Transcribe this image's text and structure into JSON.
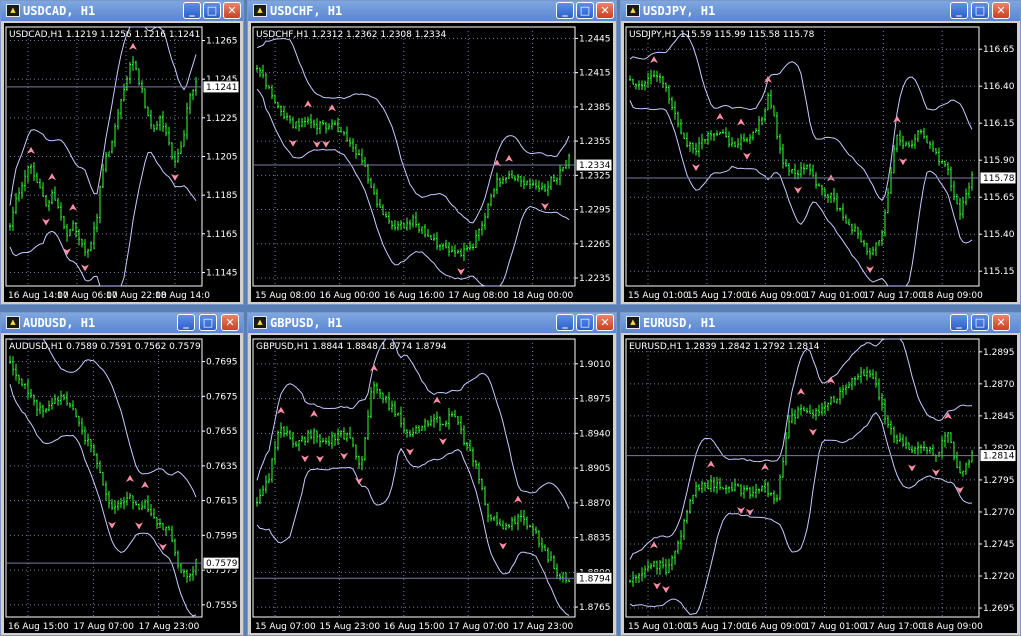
{
  "windows": [
    {
      "id": "usdcad",
      "title": "USDCAD, H1",
      "symbol_info": "USDCAD,H1  1.1219 1.1256 1.1216 1.1241",
      "last_price": "1.1241",
      "last_value": 1.1241,
      "y_ticks": [
        "1.1265",
        "1.1245",
        "1.1225",
        "1.1205",
        "1.1185",
        "1.1165",
        "1.1145"
      ],
      "y_range": [
        1.1138,
        1.1272
      ],
      "x_ticks": [
        "16 Aug 14:00",
        "17 Aug 06:00",
        "17 Aug 22:00",
        "18 Aug 14:0"
      ],
      "chart_data": {
        "type": "line",
        "series": [
          {
            "values": [
              1.117,
              1.1185,
              1.1195,
              1.12,
              1.119,
              1.118,
              1.1185,
              1.1175,
              1.1165,
              1.117,
              1.116,
              1.1155,
              1.117,
              1.12,
              1.121,
              1.1225,
              1.124,
              1.1255,
              1.1245,
              1.123,
              1.122,
              1.1225,
              1.1215,
              1.12,
              1.121,
              1.1235,
              1.1245
            ]
          }
        ]
      }
    },
    {
      "id": "usdchf",
      "title": "USDCHF, H1",
      "symbol_info": "USDCHF,H1  1.2312 1.2362 1.2308 1.2334",
      "last_price": "1.2334",
      "last_value": 1.2334,
      "y_ticks": [
        "1.2445",
        "1.2415",
        "1.2385",
        "1.2355",
        "1.2325",
        "1.2295",
        "1.2265",
        "1.2235"
      ],
      "y_range": [
        1.2228,
        1.2455
      ],
      "x_ticks": [
        "15 Aug 08:00",
        "16 Aug 00:00",
        "16 Aug 16:00",
        "17 Aug 08:00",
        "18 Aug 00:00"
      ],
      "chart_data": {
        "type": "line",
        "series": [
          {
            "values": [
              1.242,
              1.24,
              1.238,
              1.237,
              1.2372,
              1.2368,
              1.237,
              1.2365,
              1.235,
              1.233,
              1.23,
              1.2285,
              1.228,
              1.2285,
              1.2275,
              1.2265,
              1.226,
              1.2255,
              1.2265,
              1.229,
              1.232,
              1.2325,
              1.232,
              1.2318,
              1.2315,
              1.2325,
              1.234
            ]
          }
        ]
      }
    },
    {
      "id": "usdjpy",
      "title": "USDJPY, H1",
      "symbol_info": "USDJPY,H1  115.59 115.99 115.58 115.78",
      "last_price": "115.78",
      "last_value": 115.78,
      "y_ticks": [
        "116.65",
        "116.40",
        "116.15",
        "115.90",
        "115.65",
        "115.40",
        "115.15"
      ],
      "y_range": [
        115.05,
        116.8
      ],
      "x_ticks": [
        "15 Aug 01:00",
        "15 Aug 17:00",
        "16 Aug 09:00",
        "17 Aug 01:00",
        "17 Aug 17:00",
        "18 Aug 09:00"
      ],
      "chart_data": {
        "type": "line",
        "series": [
          {
            "values": [
              116.45,
              116.4,
              116.5,
              116.35,
              116.1,
              115.95,
              116.05,
              116.1,
              116.0,
              116.05,
              116.1,
              116.35,
              115.9,
              115.8,
              115.85,
              115.7,
              115.65,
              115.5,
              115.4,
              115.25,
              115.45,
              116.05,
              116.0,
              116.1,
              115.95,
              115.85,
              115.55,
              115.78
            ]
          }
        ]
      }
    },
    {
      "id": "audusd",
      "title": "AUDUSD, H1",
      "symbol_info": "AUDUSD,H1  0.7589 0.7591 0.7562 0.7579",
      "last_price": "0.7579",
      "last_value": 0.7579,
      "y_ticks": [
        "0.7695",
        "0.7675",
        "0.7655",
        "0.7635",
        "0.7615",
        "0.7595",
        "0.7575",
        "0.7555"
      ],
      "y_range": [
        0.7548,
        0.7708
      ],
      "x_ticks": [
        "16 Aug 15:00",
        "17 Aug 07:00",
        "17 Aug 23:00"
      ],
      "chart_data": {
        "type": "line",
        "series": [
          {
            "values": [
              0.7695,
              0.7685,
              0.768,
              0.767,
              0.7665,
              0.7672,
              0.7675,
              0.767,
              0.766,
              0.765,
              0.764,
              0.7625,
              0.761,
              0.7615,
              0.7618,
              0.761,
              0.7612,
              0.7605,
              0.76,
              0.7595,
              0.7575,
              0.757,
              0.758
            ]
          }
        ]
      }
    },
    {
      "id": "gbpusd",
      "title": "GBPUSD, H1",
      "symbol_info": "GBPUSD,H1  1.8844 1.8848 1.8774 1.8794",
      "last_price": "1.8794",
      "last_value": 1.8794,
      "y_ticks": [
        "1.9010",
        "1.8975",
        "1.8940",
        "1.8905",
        "1.8870",
        "1.8835",
        "1.8800",
        "1.8765"
      ],
      "y_range": [
        1.8755,
        1.9035
      ],
      "x_ticks": [
        "15 Aug 07:00",
        "15 Aug 23:00",
        "16 Aug 15:00",
        "17 Aug 07:00",
        "17 Aug 23:00"
      ],
      "chart_data": {
        "type": "line",
        "series": [
          {
            "values": [
              1.887,
              1.8895,
              1.895,
              1.893,
              1.8935,
              1.894,
              1.893,
              1.894,
              1.8935,
              1.8905,
              1.899,
              1.8975,
              1.896,
              1.894,
              1.8945,
              1.8955,
              1.895,
              1.896,
              1.893,
              1.8905,
              1.886,
              1.8845,
              1.885,
              1.8855,
              1.884,
              1.882,
              1.88,
              1.8794
            ]
          }
        ]
      }
    },
    {
      "id": "eurusd",
      "title": "EURUSD, H1",
      "symbol_info": "EURUSD,H1  1.2839 1.2842 1.2792 1.2814",
      "last_price": "1.2814",
      "last_value": 1.2814,
      "y_ticks": [
        "1.2895",
        "1.2870",
        "1.2845",
        "1.2820",
        "1.2795",
        "1.2770",
        "1.2745",
        "1.2720",
        "1.2695"
      ],
      "y_range": [
        1.2688,
        1.2905
      ],
      "x_ticks": [
        "15 Aug 01:00",
        "15 Aug 17:00",
        "16 Aug 09:00",
        "17 Aug 01:00",
        "17 Aug 17:00",
        "18 Aug 09:00"
      ],
      "chart_data": {
        "type": "line",
        "series": [
          {
            "values": [
              1.2715,
              1.272,
              1.273,
              1.2725,
              1.2745,
              1.2785,
              1.279,
              1.2792,
              1.279,
              1.2788,
              1.2785,
              1.279,
              1.278,
              1.284,
              1.285,
              1.2845,
              1.2855,
              1.286,
              1.287,
              1.288,
              1.2875,
              1.284,
              1.2825,
              1.282,
              1.2822,
              1.2815,
              1.283,
              1.28,
              1.2814
            ]
          }
        ]
      }
    }
  ],
  "controls": {
    "minimize_glyph": "_",
    "maximize_glyph": "□",
    "close_glyph": "✕",
    "app_icon_glyph": "▲"
  },
  "colors": {
    "background": "#000000",
    "candles": "#33ff33",
    "bands": "#c8c8ff",
    "grid": "#7a7aa8",
    "arrows": "#ff8fa8",
    "titlebar": "#6e97dd",
    "text": "#ffffff"
  }
}
